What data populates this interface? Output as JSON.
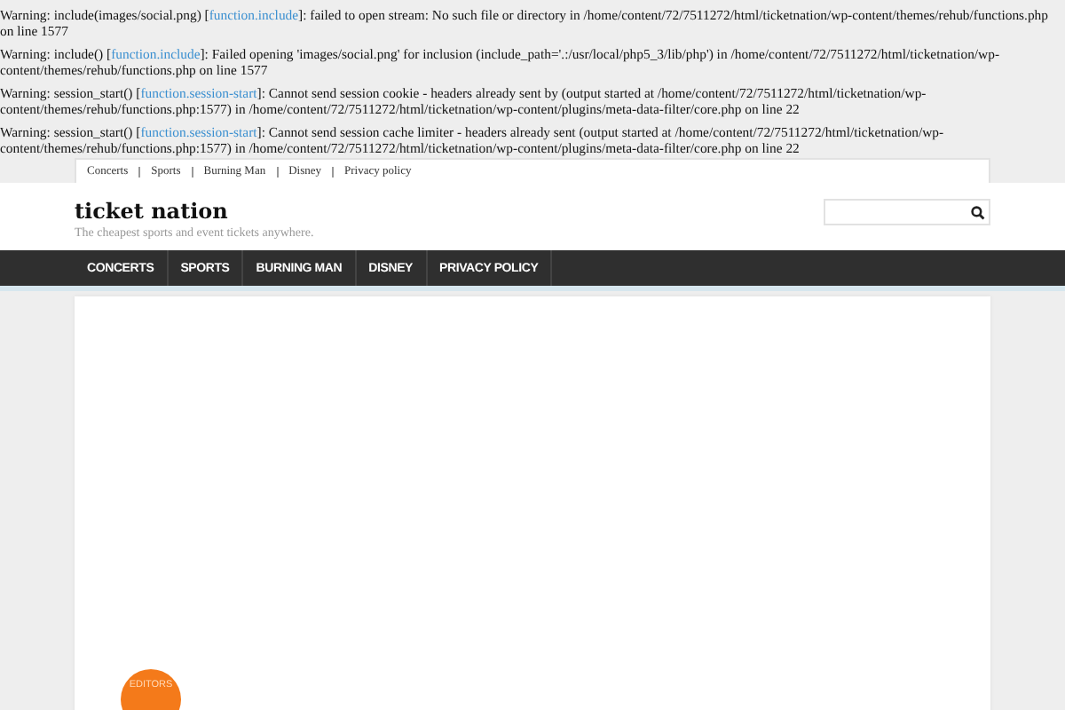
{
  "warnings": [
    {
      "before": "Warning: include(images/social.png) [",
      "link": "function.include",
      "after": "]: failed to open stream: No such file or directory in /home/content/72/7511272/html/ticketnation/wp-content/themes/rehub/functions.php on line 1577"
    },
    {
      "before": "Warning: include() [",
      "link": "function.include",
      "after": "]: Failed opening 'images/social.png' for inclusion (include_path='.:/usr/local/php5_3/lib/php') in /home/content/72/7511272/html/ticketnation/wp-content/themes/rehub/functions.php on line 1577"
    },
    {
      "before": "Warning: session_start() [",
      "link": "function.session-start",
      "after": "]: Cannot send session cookie - headers already sent by (output started at /home/content/72/7511272/html/ticketnation/wp-content/themes/rehub/functions.php:1577) in /home/content/72/7511272/html/ticketnation/wp-content/plugins/meta-data-filter/core.php on line 22"
    },
    {
      "before": "Warning: session_start() [",
      "link": "function.session-start",
      "after": "]: Cannot send session cache limiter - headers already sent (output started at /home/content/72/7511272/html/ticketnation/wp-content/themes/rehub/functions.php:1577) in /home/content/72/7511272/html/ticketnation/wp-content/plugins/meta-data-filter/core.php on line 22"
    }
  ],
  "top_menu": [
    "Concerts",
    "Sports",
    "Burning Man",
    "Disney",
    "Privacy policy"
  ],
  "site": {
    "title": "ticket nation",
    "tagline": "The cheapest sports and event tickets anywhere."
  },
  "main_menu": [
    "CONCERTS",
    "SPORTS",
    "BURNING MAN",
    "DISNEY",
    "PRIVACY POLICY"
  ],
  "badge": {
    "label": "EDITORS"
  }
}
